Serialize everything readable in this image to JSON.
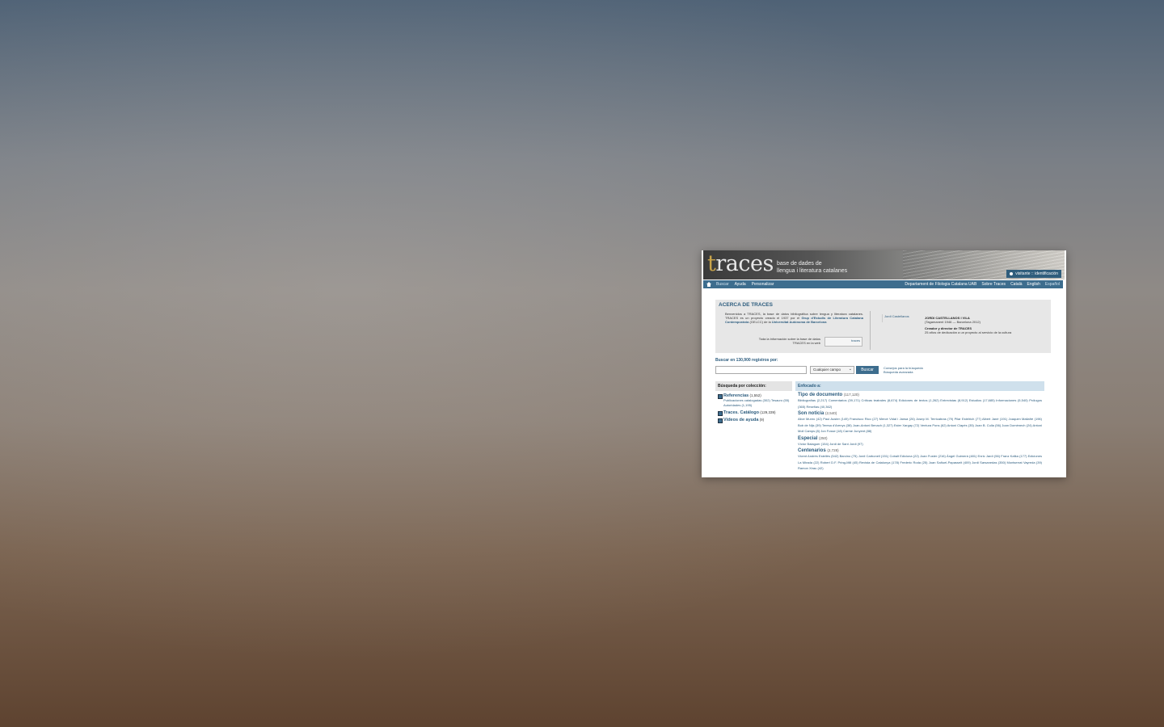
{
  "site": {
    "logo": "traces",
    "logo_first": "t",
    "logo_rest": "races",
    "tagline_line1": "base de dades de",
    "tagline_line2": "llengua i literatura catalanes"
  },
  "userbar": {
    "label": "visitante :: identificación",
    "icon": "user-icon"
  },
  "nav": {
    "left": [
      "Buscar",
      "Ayuda",
      "Personalizar"
    ],
    "right": [
      "Departament de Filologia Catalana UAB",
      "Sobre Traces",
      "Català",
      "English",
      "Español"
    ]
  },
  "about": {
    "title": "ACERCA DE TRACES",
    "intro_text": "Benvenidos a TRACES, la base de datos bibliográfica sobre lengua y literatura catalanes. TRACES es un proyecto creado el 1937 por el",
    "intro_link1": "Grup d'Estudis de Literatura Catalana Contemporània",
    "intro_mid": "(GELCC) de la",
    "intro_link2": "Universitat Autònoma de Barcelona",
    "info_text": "Toda la información sobre la base de datos TRACES en la web",
    "info_img_alt": "traces",
    "photo_alt": "Jordi Castellanos",
    "bio_name": "JORDI CASTELLANOS I VILA",
    "bio_dates": "(Tagamanent 1946 — Barcelona 2012)",
    "bio_role": "Creador y director de TRACES",
    "bio_note": "25 años de dedicación a un proyecto al servicio de la cultura"
  },
  "search": {
    "label": "Buscar en 130,900 registros por:",
    "field": "Cualquier campo",
    "button": "Buscar",
    "tips": "Consejos para la búsqueda",
    "advanced": "Búsqueda avanzada"
  },
  "collections": {
    "head": "Búsqueda por colección:",
    "items": [
      {
        "title": "Referencias",
        "count": "(1,552)",
        "sub": "Publicaciones catalogadas (302) Tesauro (55) Autoridades (1,195)"
      },
      {
        "title": "Traces. Catálogo",
        "count": "(129,339)",
        "sub": ""
      },
      {
        "title": "Vídeos de ayuda",
        "count": "(9)",
        "sub": ""
      }
    ]
  },
  "focus": {
    "head": "Enfocado a:",
    "facets": [
      {
        "title": "Tipo de documento",
        "count": "(117,120)",
        "links": "Bibliografías (2,217) Comentarios (39,171) Críticas teatrales (8,674) Ediciones de textos (1,262) Entrevistas (8,912) Estudios (17,685) Informaciones (5,540) Prólogos (365) Reseñas (40,362)"
      },
      {
        "title": "Son noticia",
        "count": "(2,540)",
        "links": "Alice Munro (42) Paul Auster (149) Francisco Rico (27) Mercè Vidal i Jansà (26) Josep M. Terricabras (79) Pilar Estelrich (77) Albert Jané (191) Joaquim Mallafrè (196) Bob de Nijs (39) Teresa d'Arenys (38) Joan-Antoni Benach (1,327) Ester Xargay (72) Ventura Pons (62) Antoni Clapés (35) Joan B. Culla (56) Joan Domènech (24) Antoni Moll Camps (8) Jon Fosse (18) Carme Junyent (88)"
      },
      {
        "title": "Especial",
        "count": "(250)",
        "links": "Víctor Balaguer (154) Jordi de Sant Jordi (97)"
      },
      {
        "title": "Centenarios",
        "count": "(2,728)",
        "links": "Vicent Andrés Estellés (542) Barcino (75) Jordi Carbonell (151) Cobalt Ediciona (22) Joan Fuster (216) Àngel Guimerà (481) Enric Jardí (56) Franz Kafka (177) Ediciones La Mirada (22) Robert D.F. Pring-Mill (45) Revista de Catalunya (178) Frederic Roda (25) Joan Sañuel-Papasseit (409) Jordi Sarsanedas (350) Montserrat Vayreda (39) Ramon Xirau (42)"
      }
    ]
  }
}
